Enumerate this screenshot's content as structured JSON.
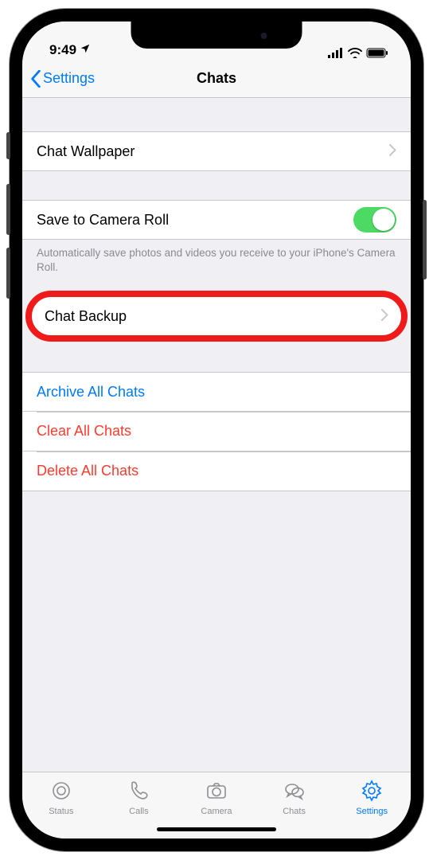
{
  "status": {
    "time": "9:49",
    "locationGlyph": "➤"
  },
  "nav": {
    "back": "Settings",
    "title": "Chats"
  },
  "rows": {
    "wallpaper": "Chat Wallpaper",
    "cameraRoll": "Save to Camera Roll",
    "cameraRollNote": "Automatically save photos and videos you receive to your iPhone's Camera Roll.",
    "backup": "Chat Backup",
    "archive": "Archive All Chats",
    "clear": "Clear All Chats",
    "delete": "Delete All Chats"
  },
  "tabs": {
    "status": "Status",
    "calls": "Calls",
    "camera": "Camera",
    "chats": "Chats",
    "settings": "Settings"
  }
}
